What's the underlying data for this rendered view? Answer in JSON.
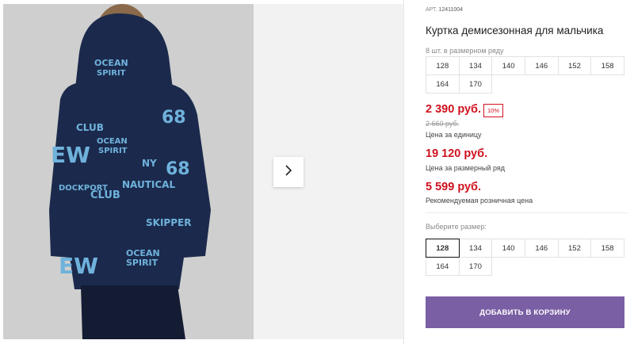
{
  "product": {
    "sku_label": "АРТ.",
    "sku": "12411004",
    "title": "Куртка демисезонная для мальчика",
    "pack_caption": "8 шт. в размерном ряду",
    "pack_sizes": [
      "128",
      "134",
      "140",
      "146",
      "152",
      "158",
      "164",
      "170"
    ]
  },
  "prices": {
    "unit_price": "2 390 руб.",
    "discount_badge": "10%",
    "old_price": "2 660 руб.",
    "unit_caption": "Цена за единицу",
    "set_price": "19 120 руб.",
    "set_caption": "Цена за размерный ряд",
    "retail_price": "5 599 руб.",
    "retail_caption": "Рекомендуемая розничная цена"
  },
  "size_select": {
    "caption": "Выберите размер:",
    "sizes": [
      "128",
      "134",
      "140",
      "146",
      "152",
      "158",
      "164",
      "170"
    ],
    "selected": "128"
  },
  "cart": {
    "button_label": "ДОБАВИТЬ В КОРЗИНУ"
  },
  "gallery": {
    "print_words": [
      "OCEAN",
      "SPIRIT",
      "CLUB",
      "NAUTICAL",
      "68",
      "SKIPPER",
      "NY",
      "EW",
      "DOCKPORT"
    ],
    "next_icon": "chevron-right-icon"
  },
  "colors": {
    "accent": "#7a5fa4",
    "price": "#d0121f",
    "jacket": "#1b2a4c",
    "print": "#6fb2dc"
  }
}
